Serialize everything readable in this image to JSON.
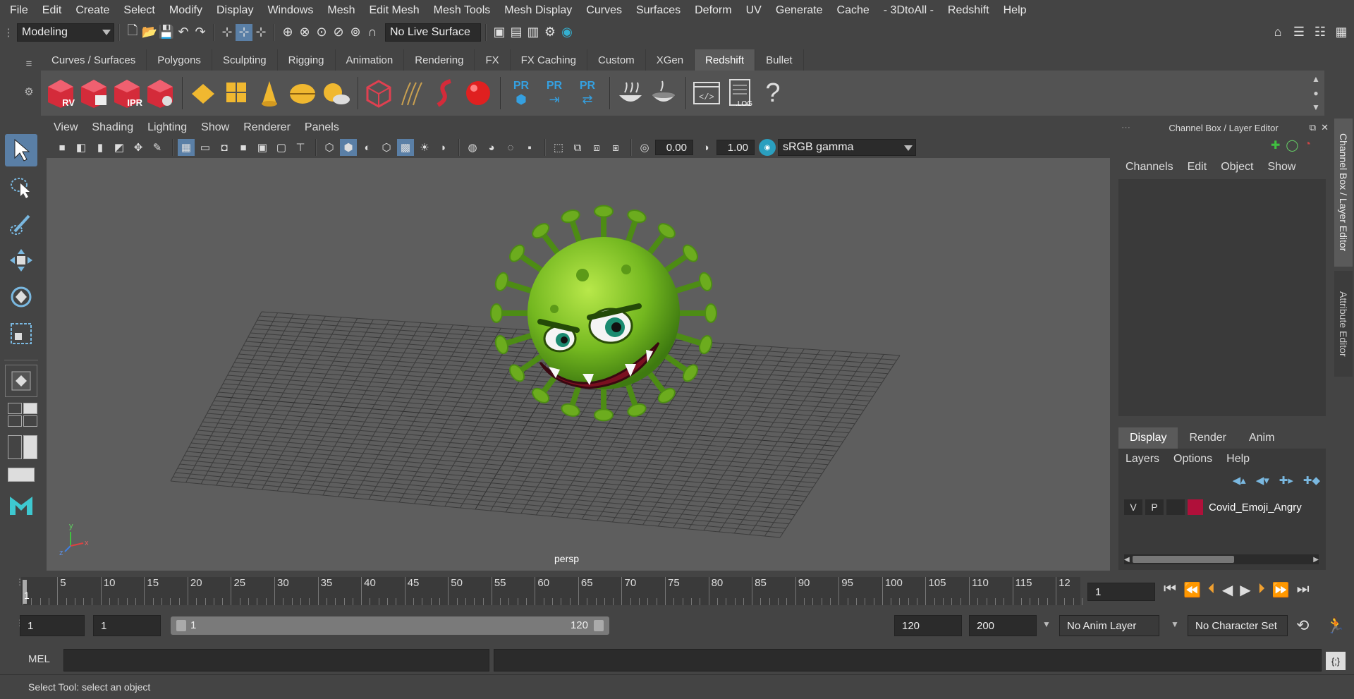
{
  "menubar": {
    "items": [
      "File",
      "Edit",
      "Create",
      "Select",
      "Modify",
      "Display",
      "Windows",
      "Mesh",
      "Edit Mesh",
      "Mesh Tools",
      "Mesh Display",
      "Curves",
      "Surfaces",
      "Deform",
      "UV",
      "Generate",
      "Cache",
      "- 3DtoAll -",
      "Redshift",
      "Help"
    ]
  },
  "statusline": {
    "workspace": "Modeling",
    "live_surface": "No Live Surface"
  },
  "shelf": {
    "tabs": [
      "Curves / Surfaces",
      "Polygons",
      "Sculpting",
      "Rigging",
      "Animation",
      "Rendering",
      "FX",
      "FX Caching",
      "Custom",
      "XGen",
      "Redshift",
      "Bullet"
    ],
    "active_tab": "Redshift",
    "icon_labels": {
      "rv": "RV",
      "ipr": "IPR",
      "pr1": "PR",
      "pr2": "PR",
      "pr3": "PR",
      "log": ".LOG",
      "help": "?"
    }
  },
  "viewport": {
    "menus": [
      "View",
      "Shading",
      "Lighting",
      "Show",
      "Renderer",
      "Panels"
    ],
    "exposure": "0.00",
    "gamma": "1.00",
    "color_space": "sRGB gamma",
    "camera_label": "persp",
    "axis_x": "x",
    "axis_y": "y",
    "axis_z": "z"
  },
  "channel_box": {
    "title": "Channel Box / Layer Editor",
    "menus": [
      "Channels",
      "Edit",
      "Object",
      "Show"
    ],
    "side_tabs": [
      "Channel Box / Layer Editor",
      "Attribute Editor"
    ]
  },
  "layer_editor": {
    "tabs": [
      "Display",
      "Render",
      "Anim"
    ],
    "active_tab": "Display",
    "menus": [
      "Layers",
      "Options",
      "Help"
    ],
    "layers": [
      {
        "v": "V",
        "p": "P",
        "color": "#b0103a",
        "name": "Covid_Emoji_Angry"
      }
    ]
  },
  "timeline": {
    "labels": [
      "5",
      "10",
      "15",
      "20",
      "25",
      "30",
      "35",
      "40",
      "45",
      "50",
      "55",
      "60",
      "65",
      "70",
      "75",
      "80",
      "85",
      "90",
      "95",
      "100",
      "105",
      "110",
      "115",
      "12"
    ],
    "current_frame_marker": "1",
    "current_frame_field": "1"
  },
  "range": {
    "start_field": "1",
    "playback_start": "1",
    "slider_start": "1",
    "slider_end": "120",
    "playback_end": "120",
    "end_field": "200",
    "anim_layer": "No Anim Layer",
    "character_set": "No Character Set"
  },
  "command_line": {
    "lang": "MEL"
  },
  "help_line": {
    "text": "Select Tool: select an object"
  },
  "colors": {
    "active_blue": "#5a7fa6",
    "redshift_red": "#d42b3a",
    "virus_green": "#7dc22a",
    "layer_red": "#b0103a"
  }
}
